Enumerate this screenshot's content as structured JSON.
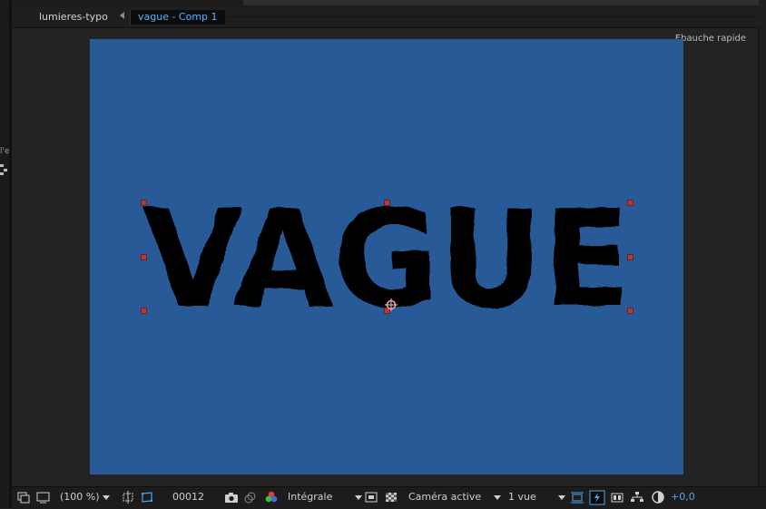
{
  "tabs": {
    "project": "lumieres-typo",
    "composition": "vague - Comp 1"
  },
  "viewer": {
    "draft_label": "Ebauche rapide",
    "text_layer": "VAGUE",
    "background_color": "#275a96"
  },
  "left_fragments": [
    "l'e"
  ],
  "toolbar": {
    "zoom": "(100 %)",
    "timecode": "00012",
    "resolution": "Intégrale",
    "camera": "Caméra active",
    "views": "1 vue",
    "exposure": "+0,0"
  },
  "colors": {
    "accent": "#56b4ff",
    "handle": "#b43a3a",
    "comp_bg": "#275a96"
  }
}
